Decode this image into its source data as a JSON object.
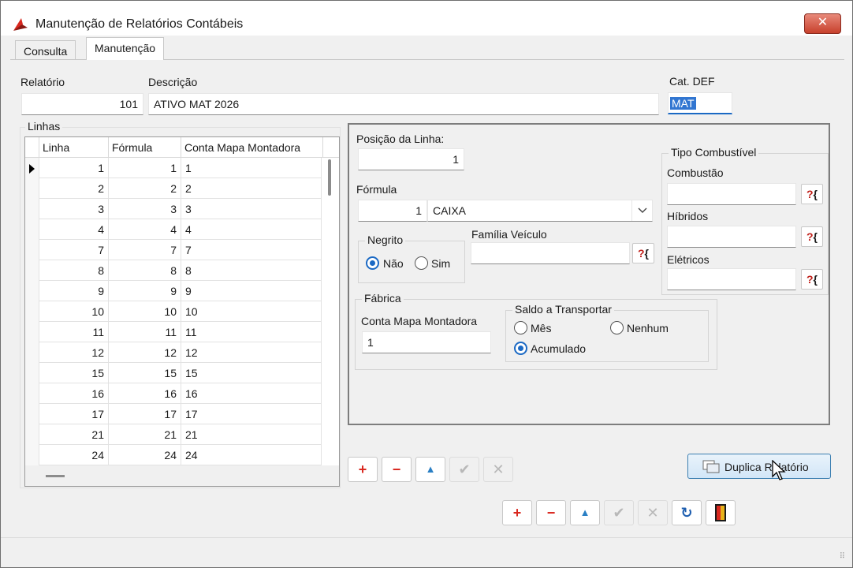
{
  "window": {
    "title": "Manutenção de Relatórios Contábeis",
    "close_label": "✕"
  },
  "tabs": [
    {
      "label": "Consulta"
    },
    {
      "label": "Manutenção",
      "active": true
    }
  ],
  "header": {
    "relatorio_label": "Relatório",
    "relatorio_value": "101",
    "descricao_label": "Descrição",
    "descricao_value": "ATIVO MAT 2026",
    "cat_label": "Cat. DEF",
    "cat_value": "MAT"
  },
  "linhas": {
    "group_title": "Linhas",
    "columns": [
      "Linha",
      "Fórmula",
      "Conta Mapa Montadora"
    ],
    "rows": [
      [
        "1",
        "1",
        "1"
      ],
      [
        "2",
        "2",
        "2"
      ],
      [
        "3",
        "3",
        "3"
      ],
      [
        "4",
        "4",
        "4"
      ],
      [
        "7",
        "7",
        "7"
      ],
      [
        "8",
        "8",
        "8"
      ],
      [
        "9",
        "9",
        "9"
      ],
      [
        "10",
        "10",
        "10"
      ],
      [
        "11",
        "11",
        "11"
      ],
      [
        "12",
        "12",
        "12"
      ],
      [
        "15",
        "15",
        "15"
      ],
      [
        "16",
        "16",
        "16"
      ],
      [
        "17",
        "17",
        "17"
      ],
      [
        "21",
        "21",
        "21"
      ],
      [
        "24",
        "24",
        "24"
      ]
    ]
  },
  "detail": {
    "posicao_label": "Posição da Linha:",
    "posicao_value": "1",
    "formula_label": "Fórmula",
    "formula_code": "1",
    "formula_name": "CAIXA",
    "negrito": {
      "title": "Negrito",
      "options": [
        "Não",
        "Sim"
      ],
      "selected": "Não"
    },
    "familia_label": "Família Veículo",
    "familia_value": "",
    "lookup_q": "?",
    "lookup_b": "{",
    "tipo_combustivel": {
      "title": "Tipo Combustível",
      "combustao_label": "Combustão",
      "combustao_value": "",
      "hibridos_label": "Híbridos",
      "hibridos_value": "",
      "eletricos_label": "Elétricos",
      "eletricos_value": ""
    },
    "fabrica": {
      "title": "Fábrica",
      "conta_label": "Conta Mapa Montadora",
      "conta_value": "1"
    },
    "saldo": {
      "title": "Saldo a Transportar",
      "mes_label": "Mês",
      "nenhum_label": "Nenhum",
      "acumulado_label": "Acumulado",
      "selected": "Acumulado"
    }
  },
  "toolbar_inner": {
    "add": "+",
    "remove": "−",
    "up": "▲",
    "confirm": "✔",
    "cancel": "✕"
  },
  "toolbar_main": {
    "add": "+",
    "remove": "−",
    "up": "▲",
    "confirm": "✔",
    "cancel": "✕",
    "refresh": "↻"
  },
  "duplica_label": "Duplica Relatório",
  "colors": {
    "accent": "#1b69c4",
    "danger": "#d9281f",
    "selection": "#3276d1"
  }
}
